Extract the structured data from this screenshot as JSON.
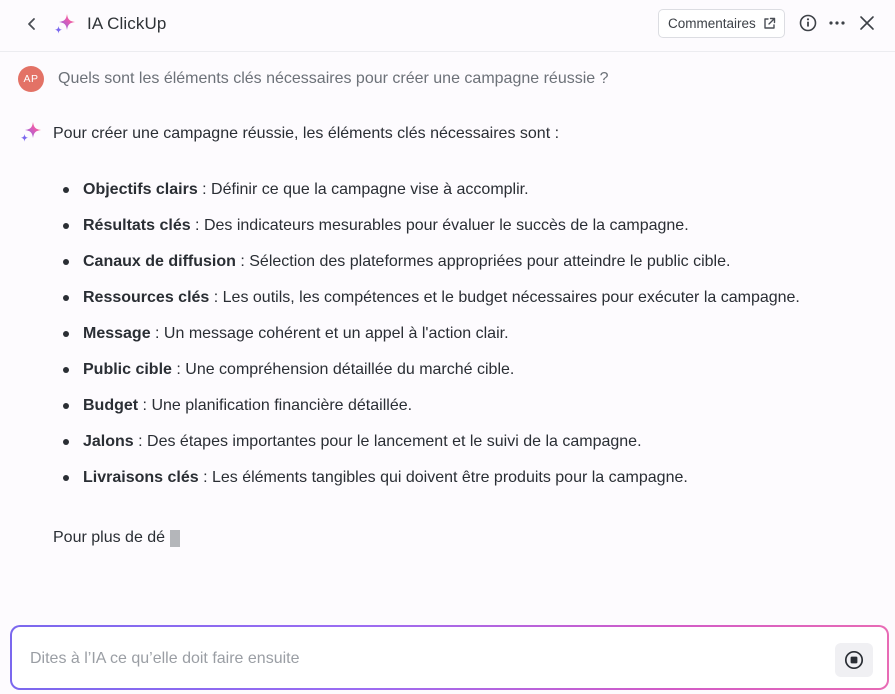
{
  "header": {
    "title": "IA ClickUp",
    "comments_label": "Commentaires",
    "icons": [
      "chevron-left-icon",
      "sparkle-icon",
      "external-link-icon",
      "info-icon",
      "more-icon",
      "close-icon"
    ]
  },
  "colors": {
    "avatar_bg": "#e37266",
    "accent_gradient": [
      "#7b68ee",
      "#e86bb5"
    ],
    "text": "#2a2e34",
    "muted_text": "#6c7178"
  },
  "conversation": {
    "user": {
      "avatar_initials": "AP",
      "question": "Quels sont les éléments clés nécessaires pour créer une campagne réussie ?"
    },
    "ai": {
      "intro": "Pour créer une campagne réussie, les éléments clés nécessaires sont :",
      "items": [
        {
          "term": "Objectifs clairs",
          "desc": " : Définir ce que la campagne vise à accomplir."
        },
        {
          "term": "Résultats clés",
          "desc": " : Des indicateurs mesurables pour évaluer le succès de la campagne."
        },
        {
          "term": "Canaux de diffusion",
          "desc": " : Sélection des plateformes appropriées pour atteindre le public cible."
        },
        {
          "term": "Ressources clés",
          "desc": " : Les outils, les compétences et le budget nécessaires pour exécuter la campagne."
        },
        {
          "term": "Message",
          "desc": " : Un message cohérent et un appel à l'action clair."
        },
        {
          "term": "Public cible",
          "desc": " : Une compréhension détaillée du marché cible."
        },
        {
          "term": "Budget",
          "desc": " : Une planification financière détaillée."
        },
        {
          "term": "Jalons",
          "desc": " : Des étapes importantes pour le lancement et le suivi de la campagne."
        },
        {
          "term": "Livraisons clés",
          "desc": " : Les éléments tangibles qui doivent être produits pour la campagne."
        }
      ],
      "partial_text": "Pour plus de dé"
    }
  },
  "input": {
    "placeholder": "Dites à l’IA ce qu’elle doit faire ensuite",
    "value": ""
  }
}
